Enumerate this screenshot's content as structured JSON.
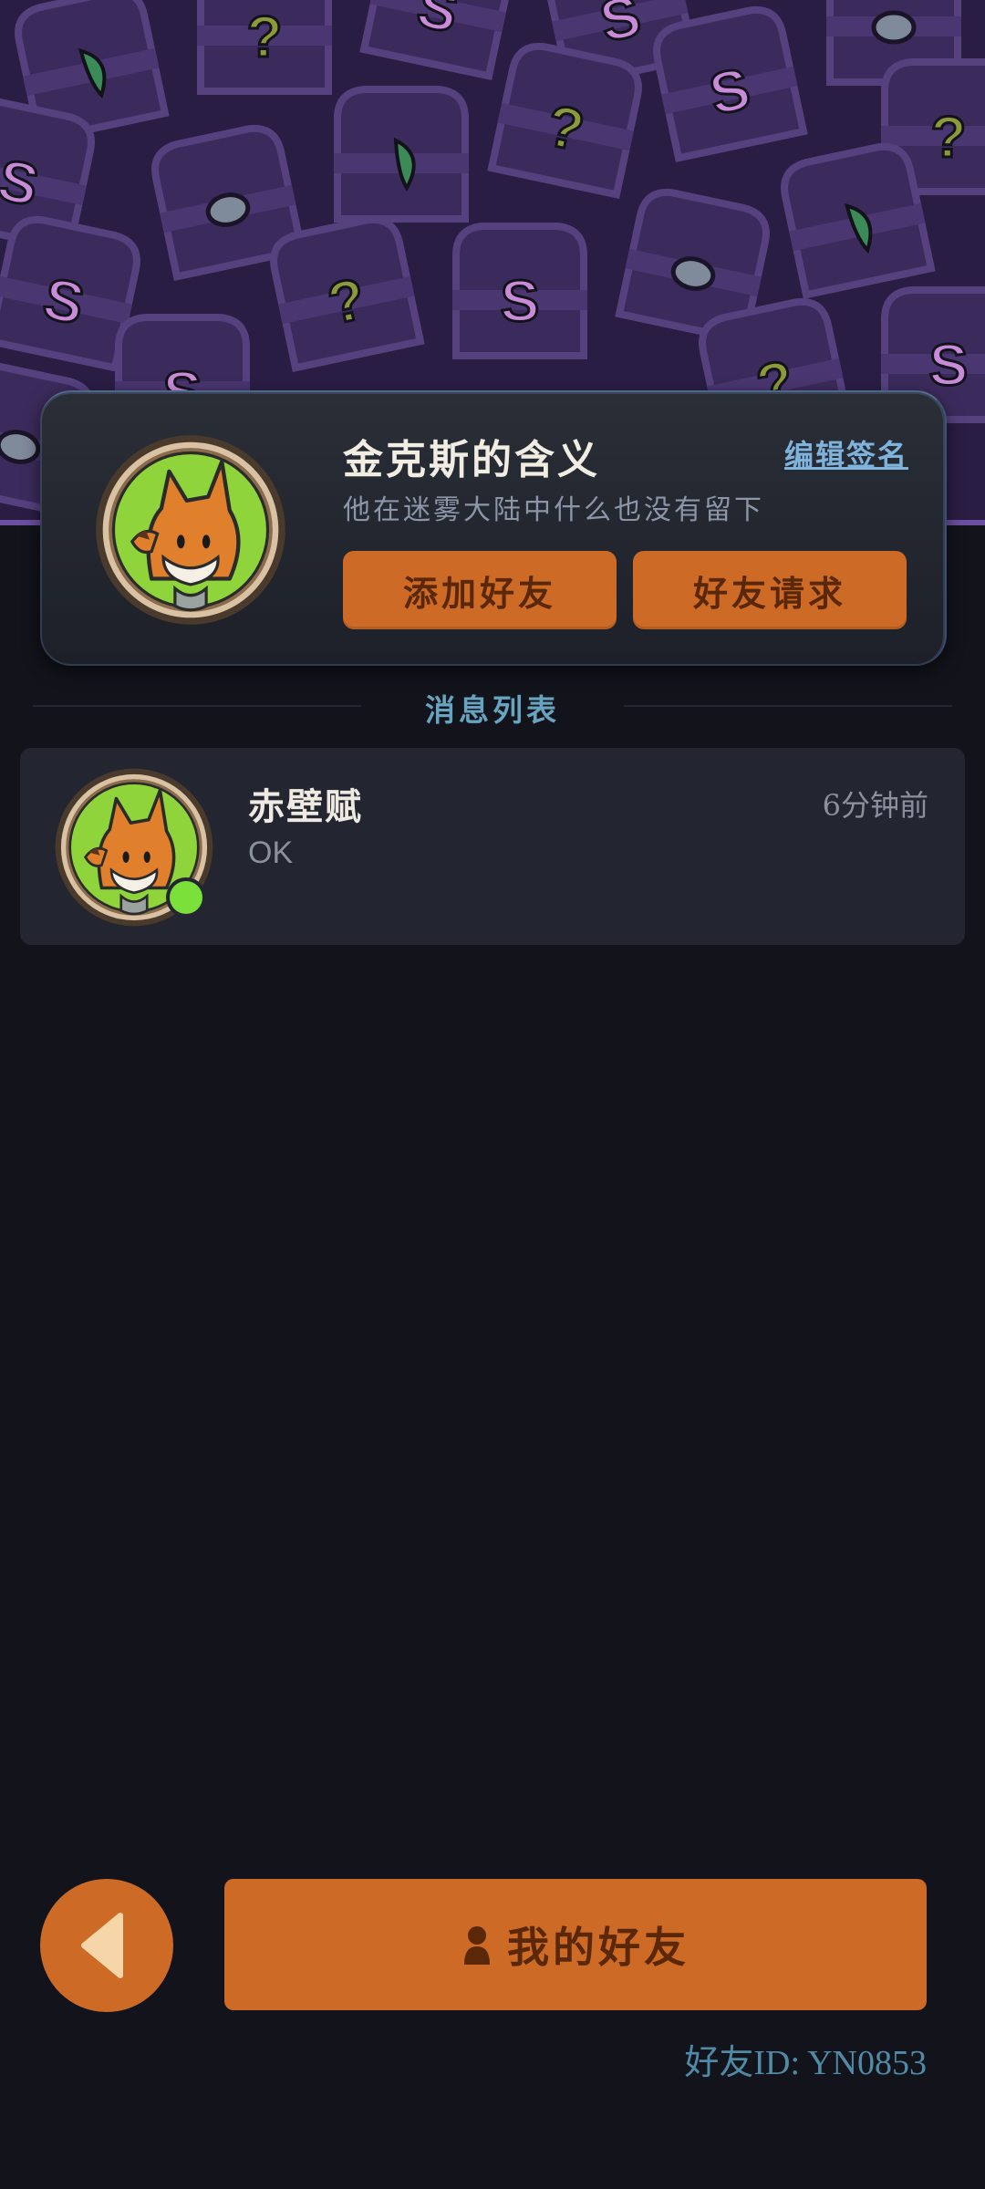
{
  "profile": {
    "name": "金克斯的含义",
    "edit_signature_label": "编辑签名",
    "signature": "他在迷雾大陆中什么也没有留下",
    "add_friend_label": "添加好友",
    "friend_requests_label": "好友请求",
    "avatar_icon": "fox-avatar-icon"
  },
  "messages": {
    "section_title": "消息列表",
    "items": [
      {
        "name": "赤壁赋",
        "preview": "OK",
        "time": "6分钟前",
        "online": true,
        "avatar_icon": "fox-avatar-icon"
      }
    ]
  },
  "footer": {
    "back_icon": "back-arrow-icon",
    "my_friends_label": "我的好友",
    "friend_id_label": "好友ID: ",
    "friend_id_value": "YN0853"
  },
  "colors": {
    "accent_orange": "#cc6a26",
    "banner_purple": "#2a1d44",
    "background": "#12131b",
    "online_green": "#7be03a",
    "link_blue": "#7fb3dc"
  }
}
